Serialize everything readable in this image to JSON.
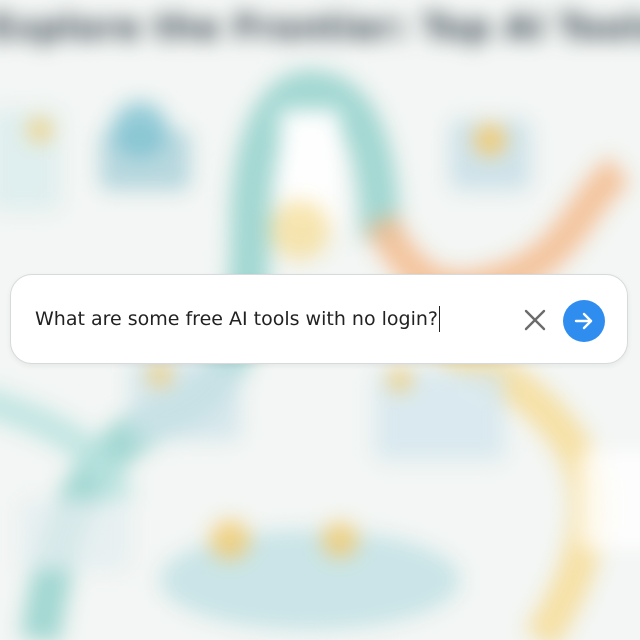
{
  "background": {
    "title": "Explore the Frontier: Top AI Tools with No Login"
  },
  "search": {
    "value": "What are some free AI tools with no login?",
    "placeholder": ""
  },
  "buttons": {
    "clear_icon": "close-icon",
    "submit_icon": "arrow-right-icon"
  },
  "colors": {
    "accent": "#2f8df0",
    "icon_gray": "#6b6b6b",
    "teal": "#7cc9c7",
    "orange": "#f5b27a",
    "yellow": "#f6d98a"
  }
}
